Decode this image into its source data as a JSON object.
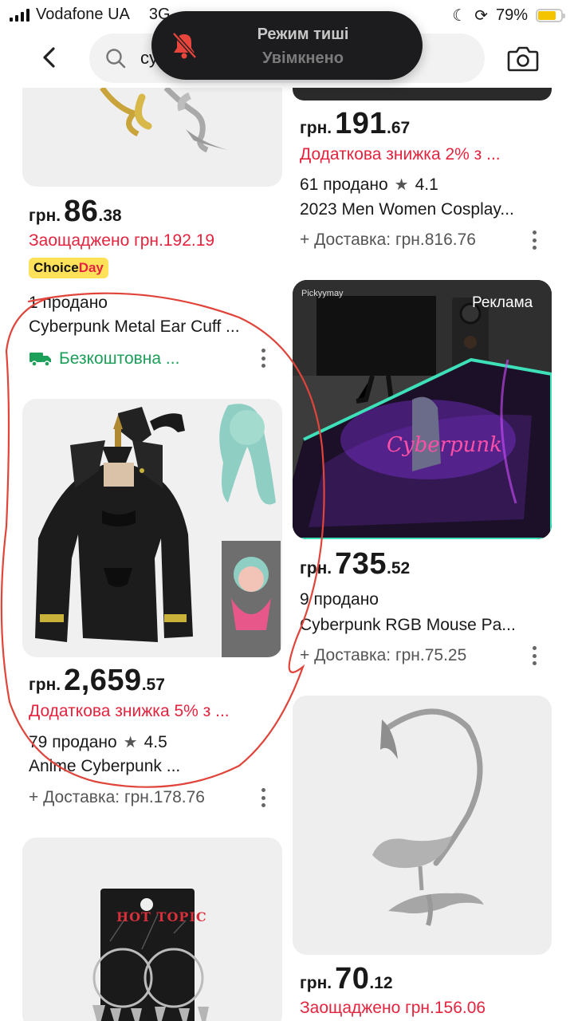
{
  "status_bar": {
    "carrier": "Vodafone UA",
    "network": "3G",
    "battery": "79%",
    "battery_level": 0.79
  },
  "header": {
    "search_text": "cy"
  },
  "silent_mode": {
    "title": "Режим тиші",
    "subtitle": "Увімкнено"
  },
  "products": {
    "p1": {
      "currency": "грн.",
      "price_int": "86",
      "price_dec": ".38",
      "promo": "Заощаджено грн.192.19",
      "badge_choice": "Choice",
      "badge_day": "Day",
      "sold": "1 продано",
      "title": "Cyberpunk Metal Ear Cuff ...",
      "shipping": "Безкоштовна ..."
    },
    "p2": {
      "currency": "грн.",
      "price_int": "191",
      "price_dec": ".67",
      "promo": "Додаткова знижка 2% з ...",
      "sold": "61 продано",
      "rating": "4.1",
      "title": "2023 Men Women Cosplay...",
      "shipping": "+ Доставка: грн.816.76"
    },
    "p3": {
      "currency": "грн.",
      "price_int": "2,659",
      "price_dec": ".57",
      "promo": "Додаткова знижка 5% з ...",
      "sold": "79 продано",
      "rating": "4.5",
      "title": "Anime Cyberpunk ...",
      "shipping": "+ Доставка: грн.178.76"
    },
    "p4": {
      "ad_label": "Реклама",
      "brand": "Pickyymay",
      "currency": "грн.",
      "price_int": "735",
      "price_dec": ".52",
      "sold": "9 продано",
      "title": "Cyberpunk RGB Mouse Pa...",
      "shipping": "+ Доставка: грн.75.25"
    },
    "p5": {
      "currency": "грн.",
      "price_int": "70",
      "price_dec": ".12",
      "promo": "Заощаджено грн.156.06"
    },
    "p6": {
      "card_text": "HOT TOPIC"
    }
  },
  "colors": {
    "promo_red": "#e4243f",
    "free_ship_green": "#1c9f59",
    "choice_yellow": "#ffe25a",
    "annotation_red": "#e0443a"
  }
}
